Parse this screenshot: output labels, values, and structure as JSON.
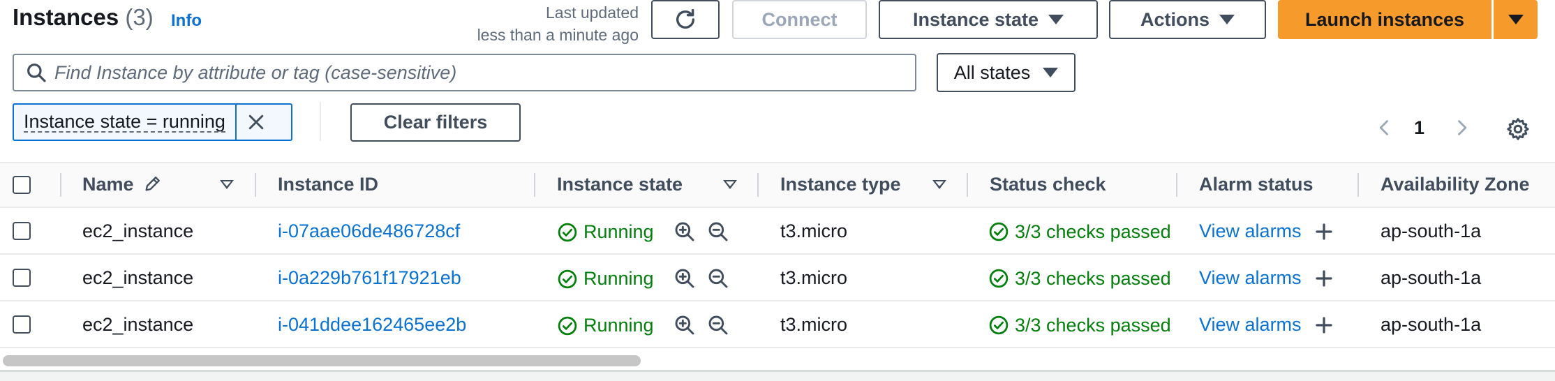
{
  "header": {
    "title": "Instances",
    "count": "(3)",
    "info_label": "Info",
    "last_updated_line1": "Last updated",
    "last_updated_line2": "less than a minute ago"
  },
  "toolbar": {
    "refresh_icon": "refresh-icon",
    "connect_label": "Connect",
    "instance_state_label": "Instance state",
    "actions_label": "Actions",
    "launch_label": "Launch instances"
  },
  "search": {
    "placeholder": "Find Instance by attribute or tag (case-sensitive)",
    "value": ""
  },
  "state_filter": {
    "selected": "All states"
  },
  "filter_token": {
    "label": "Instance state = running"
  },
  "clear_filters_label": "Clear filters",
  "pagination": {
    "current_page": "1"
  },
  "table": {
    "columns": [
      "Name",
      "Instance ID",
      "Instance state",
      "Instance type",
      "Status check",
      "Alarm status",
      "Availability Zone"
    ],
    "rows": [
      {
        "name": "ec2_instance",
        "instance_id": "i-07aae06de486728cf",
        "state": "Running",
        "type": "t3.micro",
        "status_check": "3/3 checks passed",
        "alarm": "View alarms",
        "az": "ap-south-1a"
      },
      {
        "name": "ec2_instance",
        "instance_id": "i-0a229b761f17921eb",
        "state": "Running",
        "type": "t3.micro",
        "status_check": "3/3 checks passed",
        "alarm": "View alarms",
        "az": "ap-south-1a"
      },
      {
        "name": "ec2_instance",
        "instance_id": "i-041ddee162465ee2b",
        "state": "Running",
        "type": "t3.micro",
        "status_check": "3/3 checks passed",
        "alarm": "View alarms",
        "az": "ap-south-1a"
      }
    ]
  },
  "colors": {
    "accent": "#0972d3",
    "primary_button": "#f79a2c",
    "success": "#037f0c"
  }
}
